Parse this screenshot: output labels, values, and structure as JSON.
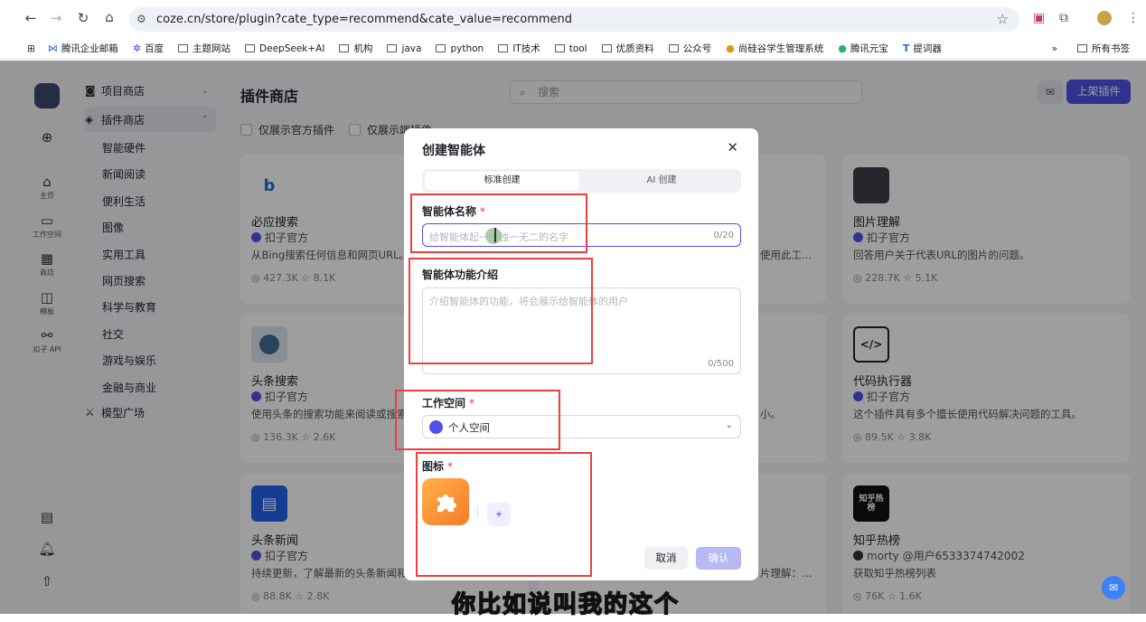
{
  "browser": {
    "url": "coze.cn/store/plugin?cate_type=recommend&cate_value=recommend",
    "bookmarks": [
      "腾讯企业邮箱",
      "百度",
      "主题网站",
      "DeepSeek+AI",
      "机构",
      "java",
      "python",
      "IT技术",
      "tool",
      "优质资料",
      "公众号",
      "尚硅谷学生管理系统",
      "腾讯元宝",
      "提词器"
    ],
    "all_bookmarks": "所有书签",
    "more": "»"
  },
  "rail": {
    "items": [
      {
        "label": "主页"
      },
      {
        "label": "工作空间"
      },
      {
        "label": "商店"
      },
      {
        "label": "模板"
      },
      {
        "label": "扣子 API"
      }
    ]
  },
  "sidebar": {
    "project_store": "项目商店",
    "plugin_store": "插件商店",
    "categories": [
      "智能硬件",
      "新闻阅读",
      "便利生活",
      "图像",
      "实用工具",
      "网页搜索",
      "科学与教育",
      "社交",
      "游戏与娱乐",
      "金融与商业"
    ],
    "model_square": "模型广场"
  },
  "main": {
    "title": "插件商店",
    "search_placeholder": "搜索",
    "publish_label": "上架插件",
    "filter_official": "仅展示官方插件",
    "filter_other": "仅展示端插件"
  },
  "cards": [
    {
      "name": "必应搜索",
      "owner": "扣子官方",
      "desc": "从Bing搜索任何信息和网页URL。",
      "stats": "427.3K  ☆ 8.1K",
      "logo": "b"
    },
    {
      "name": "图片理解",
      "owner": "扣子官方",
      "desc": "回答用户关于代表URL的图片的问题。",
      "stats": "228.7K  ☆ 5.1K",
      "logo": ""
    },
    {
      "name": "头条搜索",
      "owner": "扣子官方",
      "desc": "使用头条的搜索功能来阅读或搜索",
      "stats": "136.3K  ☆ 2.6K",
      "logo": ""
    },
    {
      "name": "代码执行器",
      "owner": "扣子官方",
      "desc": "这个插件具有多个擅长使用代码解决问题的工具。",
      "stats": "89.5K  ☆ 3.8K",
      "logo": "</>"
    },
    {
      "name": "头条新闻",
      "owner": "扣子官方",
      "desc": "持续更新，了解最新的头条新闻和",
      "stats": "88.8K  ☆ 2.8K",
      "logo": ""
    },
    {
      "name": "知乎热榜",
      "owner": "morty @用户6533374742002",
      "desc": "获取知乎热榜列表",
      "stats": "76K  ☆ 1.6K",
      "logo": "知乎热榜"
    }
  ],
  "partial_texts": {
    "mid_top": "使用此工…",
    "mid_row2": "小。",
    "mid_row3": "片理解：…"
  },
  "modal": {
    "title": "创建智能体",
    "tab_standard": "标准创建",
    "tab_ai": "AI 创建",
    "name_label": "智能体名称",
    "name_placeholder": "给智能体起一个独一无二的名字",
    "name_count": "0/20",
    "desc_label": "智能体功能介绍",
    "desc_placeholder": "介绍智能体的功能，将会展示给智能体的用户",
    "desc_count": "0/500",
    "workspace_label": "工作空间",
    "workspace_value": "个人空间",
    "icon_label": "图标",
    "cancel": "取消",
    "confirm": "确认",
    "required_mark": "*"
  },
  "video_subtitle": "你比如说叫我的这个",
  "colors": {
    "accent": "#4d53e8",
    "highlight": "#ef3e3e"
  }
}
